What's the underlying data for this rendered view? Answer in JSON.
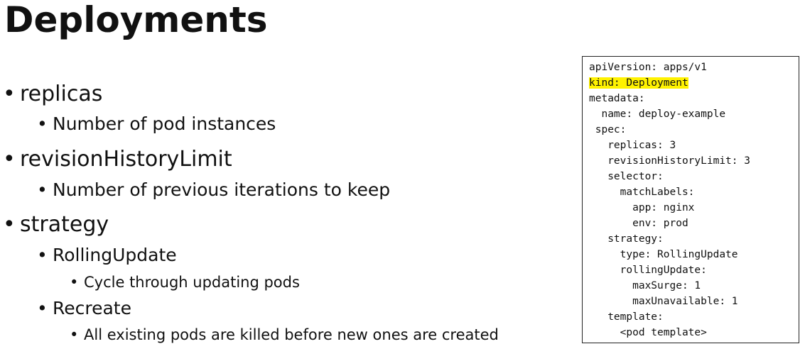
{
  "title": "Deployments",
  "bullets": {
    "replicas": "replicas",
    "replicas_desc": "Number of pod instances",
    "revision": "revisionHistoryLimit",
    "revision_desc": "Number of previous iterations to keep",
    "strategy": "strategy",
    "rolling": "RollingUpdate",
    "rolling_desc": "Cycle through updating pods",
    "recreate": "Recreate",
    "recreate_desc": "All existing pods are killed before new ones are created"
  },
  "bullet_char": "•",
  "highlight_color": "#fff200",
  "code": [
    "apiVersion: apps/v1",
    "kind: Deployment",
    "metadata:",
    "  name: deploy-example",
    " spec:",
    "   replicas: 3",
    "   revisionHistoryLimit: 3",
    "   selector:",
    "     matchLabels:",
    "       app: nginx",
    "       env: prod",
    "   strategy:",
    "     type: RollingUpdate",
    "     rollingUpdate:",
    "       maxSurge: 1",
    "       maxUnavailable: 1",
    "   template:",
    "     <pod template>"
  ]
}
